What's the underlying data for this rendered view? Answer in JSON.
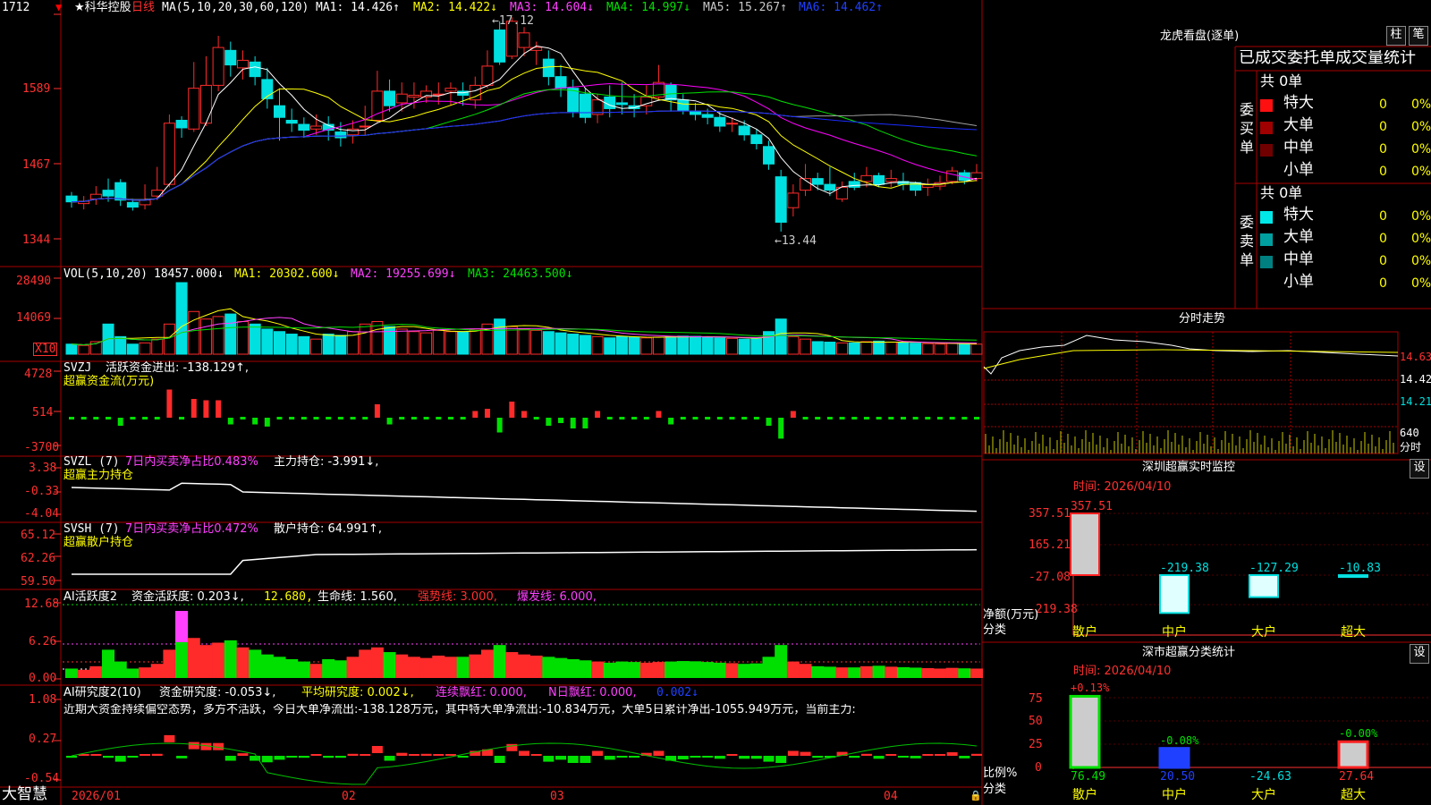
{
  "colors": {
    "up": "#ff2b2b",
    "down": "#00e0e0",
    "bg": "#000000",
    "frame": "#a80000",
    "ma1": "#ffffff",
    "ma2": "#ffff00",
    "ma3": "#ff00ff",
    "ma4": "#00e000",
    "ma5": "#a0a0a0",
    "ma6": "#1a2cff",
    "green": "#00e000",
    "magenta": "#ff40ff"
  },
  "header": {
    "stock": "★科华控股",
    "period": "日线",
    "ma_title": "MA(5,10,20,30,60,120)",
    "ma1": "MA1: 14.426↑",
    "ma2": "MA2: 14.422↓",
    "ma3": "MA3: 14.604↓",
    "ma4": "MA4: 14.997↓",
    "ma5": "MA5: 15.267↑",
    "ma6": "MA6: 14.462↑",
    "max_label": "←17.12",
    "min_label": "←13.44"
  },
  "price_axis": [
    "1712",
    "1589",
    "1467",
    "1344"
  ],
  "vol": {
    "title": "VOL(5,10,20)",
    "value": "18457.000↓",
    "ma1": "MA1: 20302.600↓",
    "ma2": "MA2: 19255.699↓",
    "ma3": "MA3: 24463.500↓",
    "axis": [
      "28490",
      "14069",
      "X10"
    ]
  },
  "svzj": {
    "title": "SVZJ",
    "line1": "活跃资金进出: -138.129↑,",
    "line2": "超赢资金流(万元)",
    "axis": [
      "4728",
      "514",
      "-3700"
    ]
  },
  "svzl": {
    "title": "SVZL (7)",
    "line1": "7日内买卖净占比0.483%",
    "line1b": "主力持仓: -3.991↓,",
    "line2": "超赢主力持仓",
    "axis": [
      "3.38",
      "-0.33",
      "-4.04"
    ]
  },
  "svsh": {
    "title": "SVSH (7)",
    "line1": "7日内买卖净占比0.472%",
    "line1b": "散户持仓: 64.991↑,",
    "line2": "超赢散户持仓",
    "axis": [
      "65.12",
      "62.26",
      "59.50"
    ]
  },
  "ai1": {
    "title": "AI活跃度2",
    "a": "资金活跃度: 0.203↓,",
    "b": "12.680,",
    "c": "生命线: 1.560,",
    "d": "强势线: 3.000,",
    "e": "爆发线: 6.000,",
    "axis": [
      "12.68",
      "6.26",
      "0.00"
    ]
  },
  "ai2": {
    "title": "AI研究度2(10)",
    "a": "资金研究度: -0.053↓,",
    "b": "平均研究度: 0.002↓,",
    "c": "连续飘红: 0.000,",
    "d": "N日飘红: 0.000,",
    "e": "0.002↓",
    "comment": "近期大资金持续偏空态势，多方不活跃，今日大单净流出:-138.128万元，其中特大单净流出:-10.834万元，大单5日累计净出-1055.949万元，当前主力:",
    "axis": [
      "1.08",
      "0.27",
      "-0.54"
    ]
  },
  "dates": [
    "2026/01",
    "02",
    "03",
    "04"
  ],
  "brand": "大智慧",
  "right": {
    "lhb_title": "龙虎看盘(逐单)",
    "btn_bar": "柱",
    "btn_pen": "笔",
    "tabs": "已成交委托单成交量统计",
    "buy_total": "共 0单",
    "sell_total": "共 0单",
    "buy_label": "委买单",
    "sell_label": "委卖单",
    "buy_rows": [
      {
        "name": "特大",
        "count": "0",
        "pct": "0%",
        "color": "#ff1010"
      },
      {
        "name": "大单",
        "count": "0",
        "pct": "0%",
        "color": "#a00000"
      },
      {
        "name": "中单",
        "count": "0",
        "pct": "0%",
        "color": "#700000"
      },
      {
        "name": "小单",
        "count": "0",
        "pct": "0%",
        "color": "#000000"
      }
    ],
    "sell_rows": [
      {
        "name": "特大",
        "count": "0",
        "pct": "0%",
        "color": "#00e8e8"
      },
      {
        "name": "大单",
        "count": "0",
        "pct": "0%",
        "color": "#00a0a0"
      },
      {
        "name": "中单",
        "count": "0",
        "pct": "0%",
        "color": "#008080"
      },
      {
        "name": "小单",
        "count": "0",
        "pct": "0%",
        "color": "#000000"
      }
    ],
    "intraday_title": "分时走势",
    "intraday_axis": [
      "14.63",
      "14.42",
      "14.21",
      "640",
      "分时"
    ],
    "sz_title": "深圳超赢实时监控",
    "sz_btn": "设",
    "sz_time": "时间: 2026/04/10",
    "sz_axis": [
      "357.51",
      "165.21",
      "-27.08",
      "-219.38"
    ],
    "sz_values": [
      {
        "cat": "散户",
        "value": 357.51,
        "label": "357.51"
      },
      {
        "cat": "中户",
        "value": -219.38,
        "label": "-219.38"
      },
      {
        "cat": "大户",
        "value": -127.29,
        "label": "-127.29"
      },
      {
        "cat": "超大",
        "value": -10.83,
        "label": "-10.83"
      }
    ],
    "sz_ylabel": "净额(万元)",
    "sz_xlabel": "分类",
    "cls_title": "深市超赢分类统计",
    "cls_btn": "设",
    "cls_time": "时间: 2026/04/10",
    "cls_axis": [
      "75",
      "50",
      "25",
      "0"
    ],
    "cls_values": [
      {
        "cat": "散户",
        "value": 76.49,
        "change": "+0.13%",
        "bottom": "76.49"
      },
      {
        "cat": "中户",
        "value": 20.5,
        "change": "-0.08%",
        "bottom": "20.50"
      },
      {
        "cat": "大户",
        "value": 0,
        "change": "",
        "bottom": "-24.63"
      },
      {
        "cat": "超大",
        "value": 27.64,
        "change": "-0.00%",
        "bottom": "27.64"
      }
    ],
    "cls_ylabel": "比例%",
    "cls_xlabel": "分类"
  },
  "chart_data": {
    "type": "candlestick",
    "title": "科华控股 日线",
    "dates": [
      "2026/01",
      "02",
      "03",
      "04"
    ],
    "ylim": [
      13.44,
      17.12
    ],
    "ohlc": [
      [
        14.05,
        13.95,
        14.12,
        13.85
      ],
      [
        13.92,
        13.96,
        14.05,
        13.82
      ],
      [
        14.0,
        14.08,
        14.22,
        13.9
      ],
      [
        14.15,
        14.05,
        14.35,
        13.95
      ],
      [
        14.28,
        13.98,
        14.34,
        13.88
      ],
      [
        13.94,
        13.86,
        14.0,
        13.8
      ],
      [
        13.9,
        13.98,
        14.25,
        13.82
      ],
      [
        14.05,
        14.15,
        14.55,
        13.98
      ],
      [
        14.25,
        15.3,
        15.45,
        14.2
      ],
      [
        15.35,
        15.22,
        15.42,
        15.05
      ],
      [
        15.2,
        15.9,
        16.35,
        15.15
      ],
      [
        15.3,
        15.95,
        16.45,
        15.25
      ],
      [
        15.95,
        16.6,
        16.8,
        15.85
      ],
      [
        16.55,
        16.3,
        16.7,
        16.1
      ],
      [
        16.25,
        16.38,
        16.55,
        16.05
      ],
      [
        16.35,
        16.1,
        16.45,
        15.95
      ],
      [
        16.05,
        15.72,
        16.25,
        15.55
      ],
      [
        15.6,
        15.4,
        15.9,
        15.0
      ],
      [
        15.35,
        15.3,
        15.55,
        15.15
      ],
      [
        15.28,
        15.18,
        15.4,
        15.05
      ],
      [
        15.2,
        15.25,
        15.45,
        15.1
      ],
      [
        15.28,
        15.18,
        15.42,
        15.0
      ],
      [
        15.15,
        15.05,
        15.32,
        14.9
      ],
      [
        15.1,
        15.2,
        15.35,
        14.95
      ],
      [
        15.25,
        15.25,
        15.6,
        15.1
      ],
      [
        15.35,
        15.85,
        16.2,
        15.3
      ],
      [
        15.85,
        15.6,
        16.05,
        15.5
      ],
      [
        15.65,
        15.8,
        16.0,
        15.5
      ],
      [
        15.75,
        15.78,
        16.0,
        15.55
      ],
      [
        15.75,
        15.85,
        15.95,
        15.65
      ],
      [
        15.8,
        15.8,
        16.0,
        15.62
      ],
      [
        15.85,
        15.9,
        16.0,
        15.6
      ],
      [
        15.85,
        15.78,
        16.0,
        15.6
      ],
      [
        15.7,
        15.95,
        16.1,
        15.55
      ],
      [
        15.95,
        16.28,
        16.55,
        15.9
      ],
      [
        16.9,
        16.35,
        17.05,
        16.3
      ],
      [
        16.45,
        17.05,
        17.12,
        16.4
      ],
      [
        16.6,
        16.85,
        16.95,
        16.45
      ],
      [
        16.55,
        16.6,
        16.7,
        16.3
      ],
      [
        16.4,
        16.1,
        16.55,
        15.95
      ],
      [
        16.1,
        15.9,
        16.3,
        15.75
      ],
      [
        15.9,
        15.5,
        16.05,
        15.4
      ],
      [
        15.8,
        15.4,
        15.9,
        15.3
      ],
      [
        15.45,
        15.7,
        15.8,
        15.3
      ],
      [
        15.75,
        15.55,
        15.95,
        15.4
      ],
      [
        15.65,
        15.62,
        16.0,
        15.45
      ],
      [
        15.6,
        15.55,
        15.8,
        15.4
      ],
      [
        15.6,
        15.75,
        15.95,
        15.45
      ],
      [
        15.75,
        16.0,
        16.3,
        15.7
      ],
      [
        15.95,
        15.7,
        16.0,
        15.5
      ],
      [
        15.7,
        15.52,
        15.8,
        15.45
      ],
      [
        15.5,
        15.45,
        15.65,
        15.35
      ],
      [
        15.45,
        15.4,
        15.55,
        15.28
      ],
      [
        15.4,
        15.25,
        15.5,
        15.15
      ],
      [
        15.3,
        15.3,
        15.4,
        15.15
      ],
      [
        15.25,
        15.1,
        15.35,
        15.0
      ],
      [
        15.1,
        14.95,
        15.2,
        14.85
      ],
      [
        14.9,
        14.6,
        15.0,
        14.5
      ],
      [
        14.38,
        13.6,
        14.5,
        13.44
      ],
      [
        13.85,
        14.1,
        14.25,
        13.7
      ],
      [
        14.15,
        14.35,
        14.6,
        14.05
      ],
      [
        14.35,
        14.25,
        14.45,
        14.15
      ],
      [
        14.25,
        14.15,
        14.55,
        14.05
      ],
      [
        14.0,
        14.2,
        14.3,
        13.95
      ],
      [
        14.3,
        14.2,
        14.45,
        14.15
      ],
      [
        14.3,
        14.4,
        14.55,
        14.2
      ],
      [
        14.4,
        14.25,
        14.45,
        14.2
      ],
      [
        14.3,
        14.35,
        14.5,
        14.2
      ],
      [
        14.3,
        14.25,
        14.45,
        14.15
      ],
      [
        14.28,
        14.15,
        14.3,
        14.05
      ],
      [
        14.2,
        14.25,
        14.35,
        14.05
      ],
      [
        14.22,
        14.28,
        14.4,
        14.15
      ],
      [
        14.3,
        14.48,
        14.55,
        14.25
      ],
      [
        14.45,
        14.32,
        14.5,
        14.25
      ],
      [
        14.35,
        14.45,
        14.6,
        14.3
      ]
    ],
    "volume": [
      4000,
      3500,
      5000,
      12000,
      7000,
      4000,
      4500,
      6000,
      12000,
      28490,
      17000,
      14000,
      15000,
      16000,
      13000,
      12000,
      10000,
      9000,
      8000,
      7000,
      6000,
      8000,
      7500,
      9000,
      12000,
      13000,
      11000,
      10000,
      9000,
      8500,
      9500,
      9000,
      9000,
      10000,
      12000,
      14000,
      11000,
      10000,
      9500,
      9000,
      8500,
      8000,
      7500,
      7000,
      6500,
      7000,
      6800,
      6500,
      6800,
      7000,
      7200,
      7100,
      6800,
      6500,
      6300,
      6000,
      6200,
      9000,
      14000,
      7000,
      6000,
      5000,
      4800,
      4500,
      4500,
      5000,
      5200,
      4800,
      4600,
      4400,
      4200,
      4000,
      4300,
      4100,
      4000
    ],
    "overlay_ma_values": {
      "MA1": 14.426,
      "MA2": 14.422,
      "MA3": 14.604,
      "MA4": 14.997,
      "MA5": 15.267,
      "MA6": 14.462
    }
  }
}
